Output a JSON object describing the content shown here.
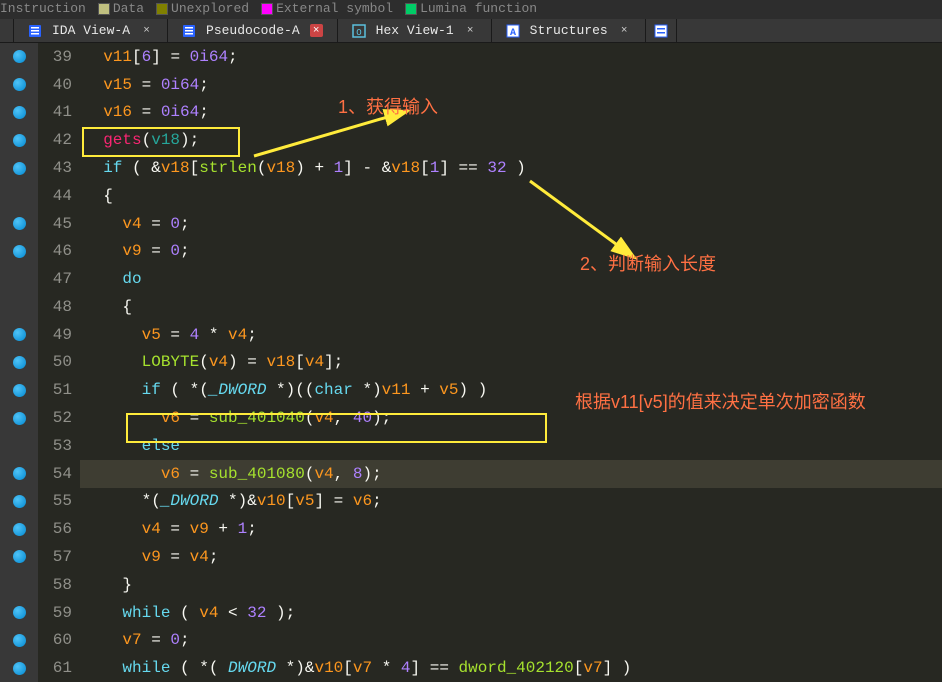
{
  "legend": {
    "instruction": "Instruction",
    "data": "Data",
    "unexplored": "Unexplored",
    "external": "External symbol",
    "lumina": "Lumina function"
  },
  "tabs": [
    {
      "label": "IDA View-A",
      "active": false
    },
    {
      "label": "Pseudocode-A",
      "active": true
    },
    {
      "label": "Hex View-1",
      "active": false
    },
    {
      "label": "Structures",
      "active": false
    }
  ],
  "code_lines": [
    {
      "n": 39,
      "bp": true,
      "ind": 1,
      "tokens": [
        [
          "var",
          "v11"
        ],
        [
          "op",
          "["
        ],
        [
          "num",
          "6"
        ],
        [
          "op",
          "] = "
        ],
        [
          "num",
          "0i64"
        ],
        [
          "op",
          ";"
        ]
      ]
    },
    {
      "n": 40,
      "bp": true,
      "ind": 1,
      "tokens": [
        [
          "var",
          "v15"
        ],
        [
          "op",
          " = "
        ],
        [
          "num",
          "0i64"
        ],
        [
          "op",
          ";"
        ]
      ]
    },
    {
      "n": 41,
      "bp": true,
      "ind": 1,
      "tokens": [
        [
          "var",
          "v16"
        ],
        [
          "op",
          " = "
        ],
        [
          "num",
          "0i64"
        ],
        [
          "op",
          ";"
        ]
      ]
    },
    {
      "n": 42,
      "bp": true,
      "ind": 1,
      "tokens": [
        [
          "call",
          "gets"
        ],
        [
          "op",
          "("
        ],
        [
          "vteal",
          "v18"
        ],
        [
          "op",
          ");"
        ]
      ]
    },
    {
      "n": 43,
      "bp": true,
      "ind": 1,
      "tokens": [
        [
          "kw",
          "if"
        ],
        [
          "op",
          " ( &"
        ],
        [
          "var",
          "v18"
        ],
        [
          "op",
          "["
        ],
        [
          "func",
          "strlen"
        ],
        [
          "op",
          "("
        ],
        [
          "var",
          "v18"
        ],
        [
          "op",
          ") + "
        ],
        [
          "num",
          "1"
        ],
        [
          "op",
          "] - &"
        ],
        [
          "var",
          "v18"
        ],
        [
          "op",
          "["
        ],
        [
          "num",
          "1"
        ],
        [
          "op",
          "] == "
        ],
        [
          "num",
          "32"
        ],
        [
          "op",
          " )"
        ]
      ]
    },
    {
      "n": 44,
      "bp": false,
      "ind": 1,
      "tokens": [
        [
          "op",
          "{"
        ]
      ]
    },
    {
      "n": 45,
      "bp": true,
      "ind": 2,
      "tokens": [
        [
          "var",
          "v4"
        ],
        [
          "op",
          " = "
        ],
        [
          "num",
          "0"
        ],
        [
          "op",
          ";"
        ]
      ]
    },
    {
      "n": 46,
      "bp": true,
      "ind": 2,
      "tokens": [
        [
          "var",
          "v9"
        ],
        [
          "op",
          " = "
        ],
        [
          "num",
          "0"
        ],
        [
          "op",
          ";"
        ]
      ]
    },
    {
      "n": 47,
      "bp": false,
      "ind": 2,
      "tokens": [
        [
          "kw",
          "do"
        ]
      ]
    },
    {
      "n": 48,
      "bp": false,
      "ind": 2,
      "tokens": [
        [
          "op",
          "{"
        ]
      ]
    },
    {
      "n": 49,
      "bp": true,
      "ind": 3,
      "tokens": [
        [
          "var",
          "v5"
        ],
        [
          "op",
          " = "
        ],
        [
          "num",
          "4"
        ],
        [
          "op",
          " * "
        ],
        [
          "var",
          "v4"
        ],
        [
          "op",
          ";"
        ]
      ]
    },
    {
      "n": 50,
      "bp": true,
      "ind": 3,
      "tokens": [
        [
          "func",
          "LOBYTE"
        ],
        [
          "op",
          "("
        ],
        [
          "var",
          "v4"
        ],
        [
          "op",
          ") = "
        ],
        [
          "var",
          "v18"
        ],
        [
          "op",
          "["
        ],
        [
          "var",
          "v4"
        ],
        [
          "op",
          "];"
        ]
      ]
    },
    {
      "n": 51,
      "bp": true,
      "ind": 3,
      "tokens": [
        [
          "kw",
          "if"
        ],
        [
          "op",
          " ( *("
        ],
        [
          "type",
          "_DWORD "
        ],
        [
          "op",
          "*)(("
        ],
        [
          "kw",
          "char"
        ],
        [
          "op",
          " *)"
        ],
        [
          "var",
          "v11"
        ],
        [
          "op",
          " + "
        ],
        [
          "var",
          "v5"
        ],
        [
          "op",
          ") )"
        ]
      ]
    },
    {
      "n": 52,
      "bp": true,
      "ind": 4,
      "tokens": [
        [
          "var",
          "v6"
        ],
        [
          "op",
          " = "
        ],
        [
          "func",
          "sub_401040"
        ],
        [
          "op",
          "("
        ],
        [
          "var",
          "v4"
        ],
        [
          "op",
          ", "
        ],
        [
          "num",
          "40"
        ],
        [
          "op",
          ");"
        ]
      ]
    },
    {
      "n": 53,
      "bp": false,
      "ind": 3,
      "tokens": [
        [
          "kw",
          "else"
        ]
      ]
    },
    {
      "n": 54,
      "bp": true,
      "ind": 4,
      "sel": true,
      "tokens": [
        [
          "var",
          "v6"
        ],
        [
          "op",
          " = "
        ],
        [
          "func",
          "sub_401080"
        ],
        [
          "op",
          "("
        ],
        [
          "var",
          "v4"
        ],
        [
          "op",
          ", "
        ],
        [
          "num",
          "8"
        ],
        [
          "op",
          ");"
        ]
      ]
    },
    {
      "n": 55,
      "bp": true,
      "ind": 3,
      "tokens": [
        [
          "op",
          "*("
        ],
        [
          "type",
          "_DWORD "
        ],
        [
          "op",
          "*)&"
        ],
        [
          "var",
          "v10"
        ],
        [
          "op",
          "["
        ],
        [
          "var",
          "v5"
        ],
        [
          "op",
          "] = "
        ],
        [
          "var",
          "v6"
        ],
        [
          "op",
          ";"
        ]
      ]
    },
    {
      "n": 56,
      "bp": true,
      "ind": 3,
      "tokens": [
        [
          "var",
          "v4"
        ],
        [
          "op",
          " = "
        ],
        [
          "var",
          "v9"
        ],
        [
          "op",
          " + "
        ],
        [
          "num",
          "1"
        ],
        [
          "op",
          ";"
        ]
      ]
    },
    {
      "n": 57,
      "bp": true,
      "ind": 3,
      "tokens": [
        [
          "var",
          "v9"
        ],
        [
          "op",
          " = "
        ],
        [
          "var",
          "v4"
        ],
        [
          "op",
          ";"
        ]
      ]
    },
    {
      "n": 58,
      "bp": false,
      "ind": 2,
      "tokens": [
        [
          "op",
          "}"
        ]
      ]
    },
    {
      "n": 59,
      "bp": true,
      "ind": 2,
      "tokens": [
        [
          "kw",
          "while"
        ],
        [
          "op",
          " ( "
        ],
        [
          "var",
          "v4"
        ],
        [
          "op",
          " < "
        ],
        [
          "num",
          "32"
        ],
        [
          "op",
          " );"
        ]
      ]
    },
    {
      "n": 60,
      "bp": true,
      "ind": 2,
      "tokens": [
        [
          "var",
          "v7"
        ],
        [
          "op",
          " = "
        ],
        [
          "num",
          "0"
        ],
        [
          "op",
          ";"
        ]
      ]
    },
    {
      "n": 61,
      "bp": true,
      "ind": 2,
      "tokens": [
        [
          "kw",
          "while"
        ],
        [
          "op",
          " ( *("
        ],
        [
          "type",
          " DWORD "
        ],
        [
          "op",
          "*)&"
        ],
        [
          "var",
          "v10"
        ],
        [
          "op",
          "["
        ],
        [
          "var",
          "v7"
        ],
        [
          "op",
          " * "
        ],
        [
          "num",
          "4"
        ],
        [
          "op",
          "] == "
        ],
        [
          "func",
          "dword_402120"
        ],
        [
          "op",
          "["
        ],
        [
          "var",
          "v7"
        ],
        [
          "op",
          "] )"
        ]
      ]
    }
  ],
  "annotations": {
    "a1": "1、获得输入",
    "a2": "2、判断输入长度",
    "a3": "根据v11[v5]的值来决定单次加密函数"
  },
  "colors": {
    "instruction": "#3a6ea5",
    "data": "#c0c080",
    "unexplored": "#808000",
    "external": "#ff00ff",
    "lumina": "#00cc66"
  }
}
